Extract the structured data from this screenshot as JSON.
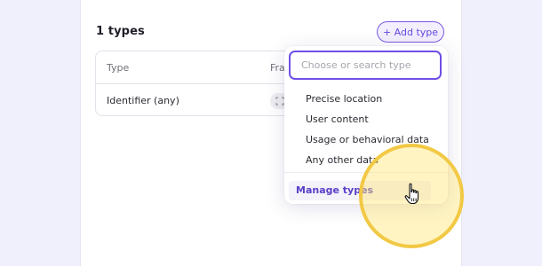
{
  "panel": {
    "title": "1 types",
    "add_button_label": "+ Add type"
  },
  "table": {
    "columns": [
      "Type",
      "Fra"
    ],
    "rows": [
      {
        "type": "Identifier (any)"
      }
    ]
  },
  "dropdown": {
    "search_placeholder": "Choose or search type",
    "options": [
      "Precise location",
      "User content",
      "Usage or behavioral data",
      "Any other data"
    ],
    "manage_label": "Manage types"
  },
  "colors": {
    "accent": "#6f4fe6",
    "highlight": "#f2c945",
    "background": "#f0f0fc"
  },
  "icons": {
    "cursor": "hand-pointer-icon"
  }
}
